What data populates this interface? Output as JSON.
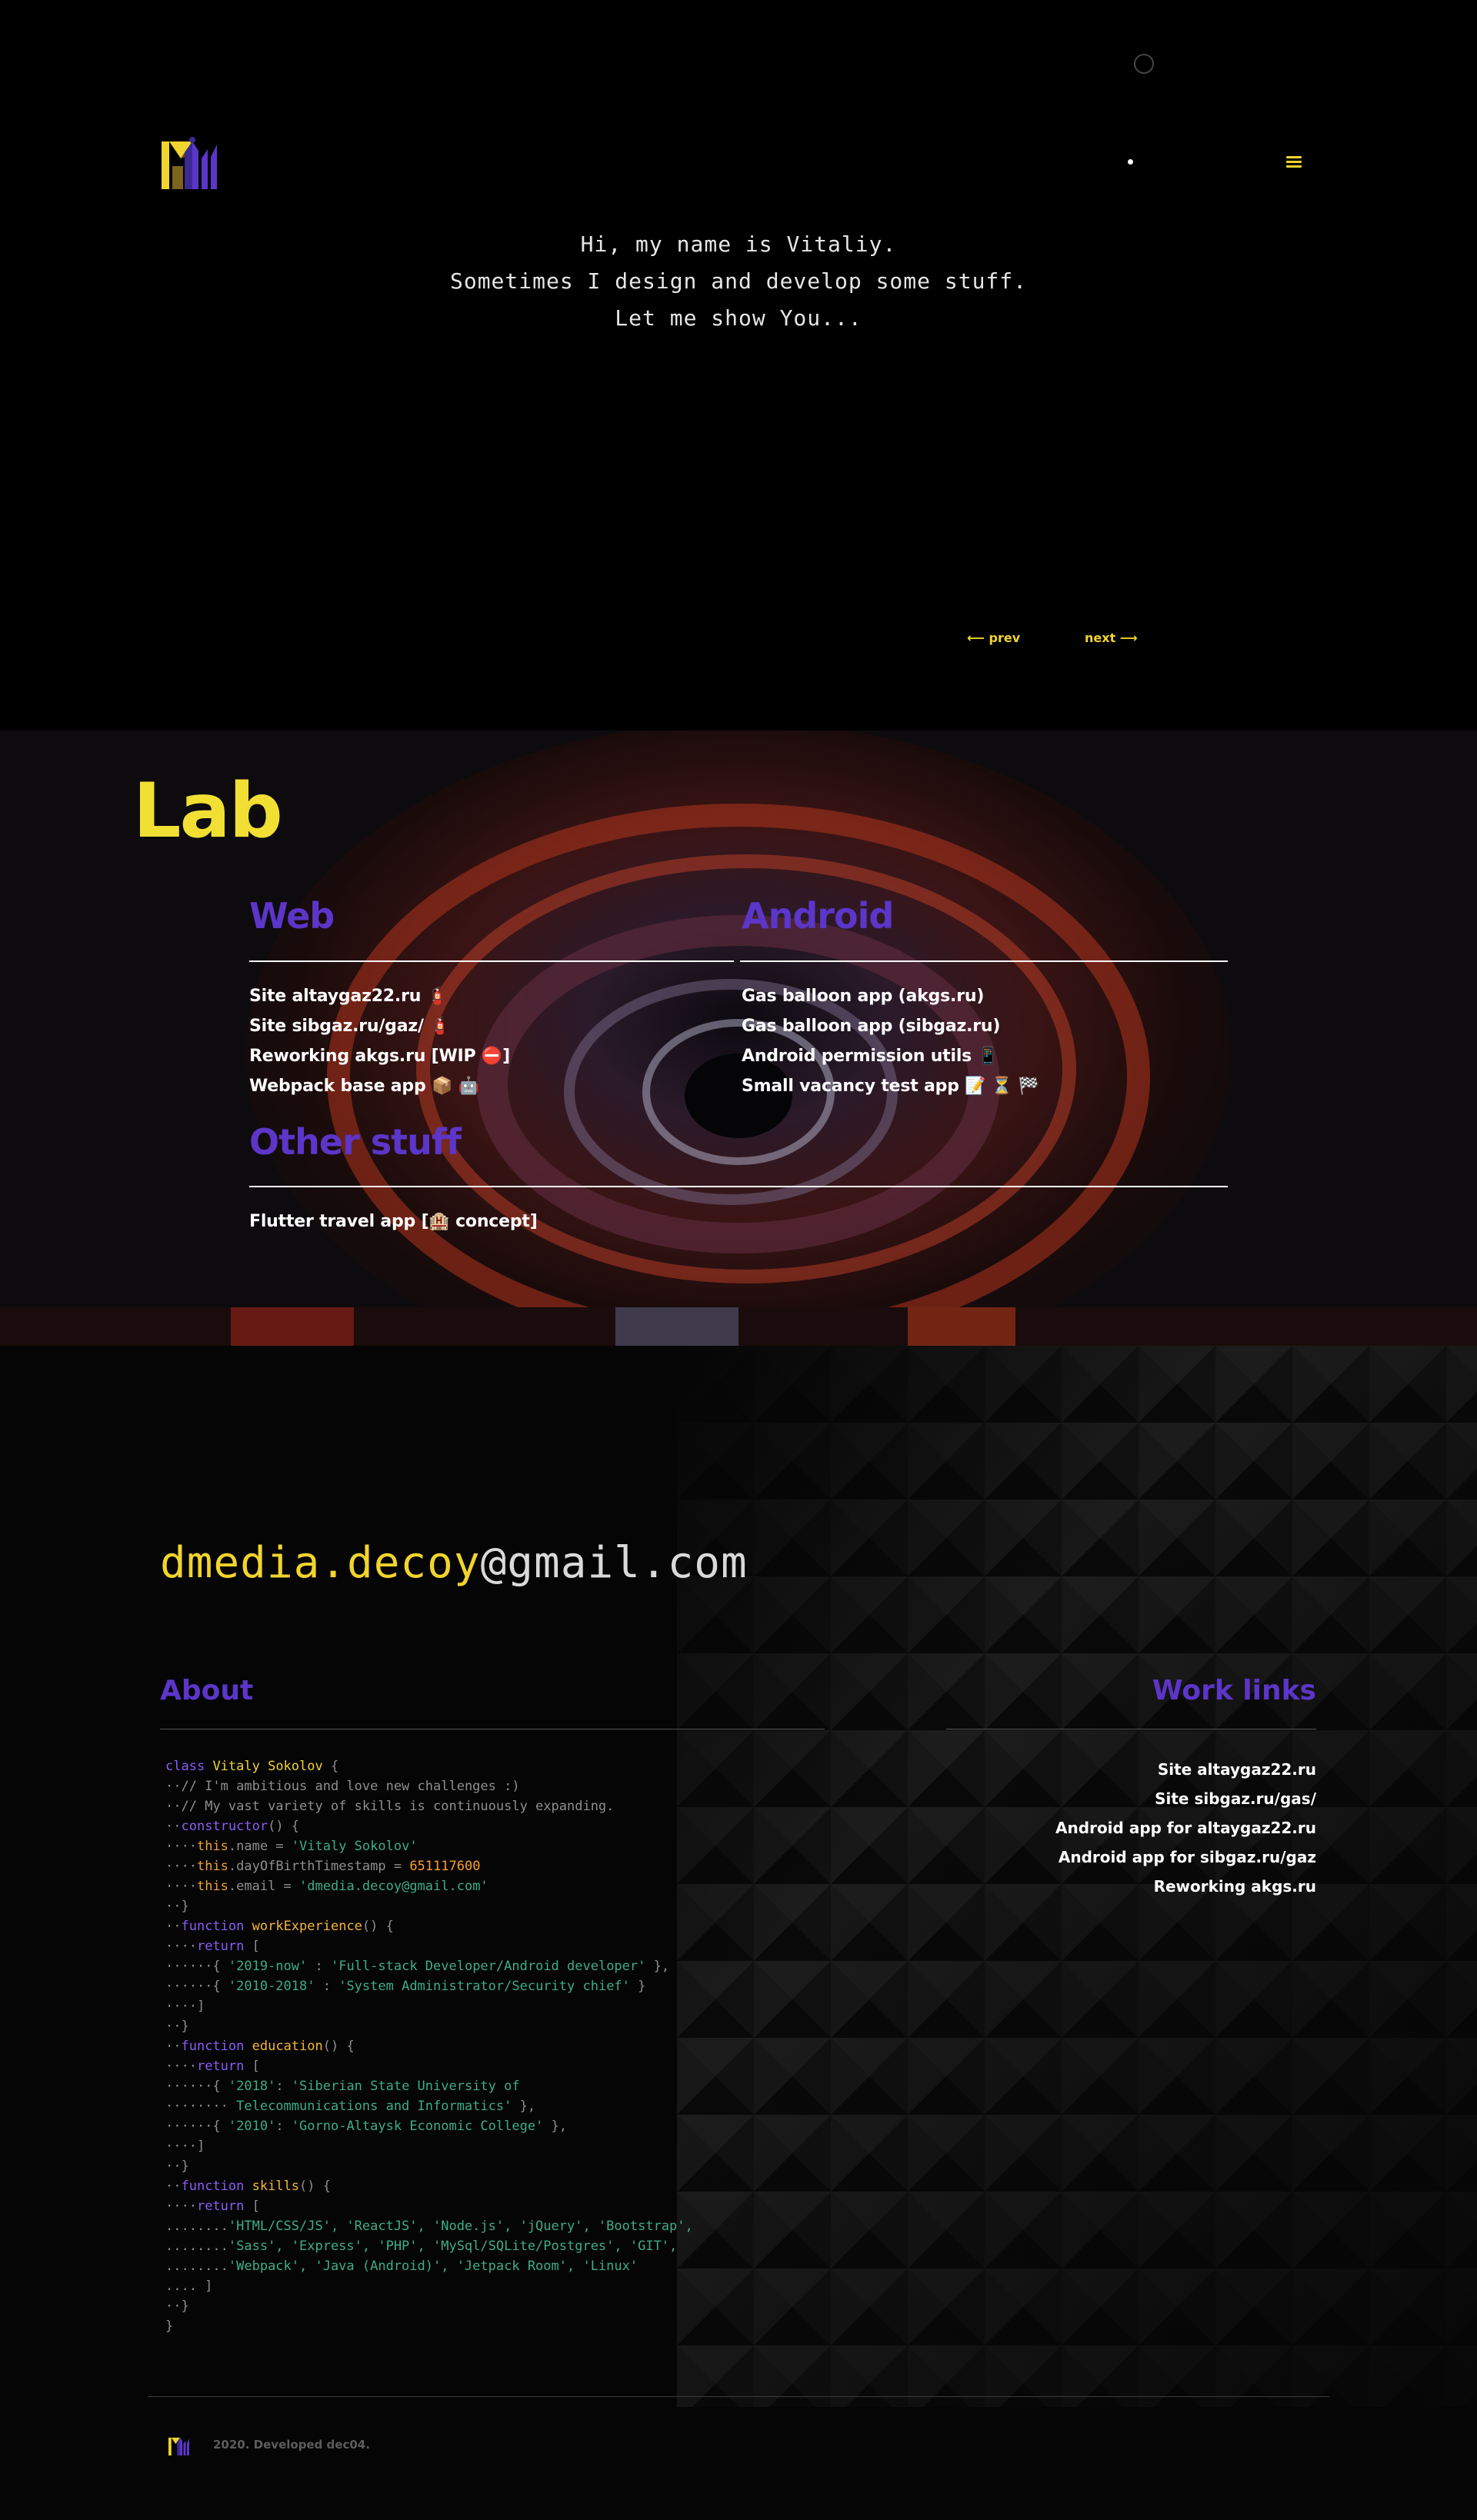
{
  "hero": {
    "intro_lines": [
      "Hi, my name is Vitaliy.",
      "Sometimes I design and develop some stuff.",
      "Let me show You..."
    ],
    "prev_label": "⟵ prev",
    "next_label": "next ⟶"
  },
  "lab": {
    "title": "Lab",
    "web": {
      "title": "Web",
      "items": [
        "Site altaygaz22.ru 🧯",
        "Site sibgaz.ru/gaz/ 🧯",
        "Reworking akgs.ru [WIP ⛔]",
        "Webpack base app 📦 🤖"
      ]
    },
    "android": {
      "title": "Android",
      "items": [
        "Gas balloon app (akgs.ru)",
        "Gas balloon app (sibgaz.ru)",
        "Android permission utils 📱",
        "Small vacancy test app 📝 ⏳ 🏁"
      ]
    },
    "other": {
      "title": "Other stuff",
      "items": [
        "Flutter travel app [🏨 concept]"
      ]
    }
  },
  "contact": {
    "email_local": "dmedia.decoy",
    "email_domain": "@gmail.com",
    "about_title": "About",
    "work_links_title": "Work links",
    "work_links": [
      "Site altaygaz22.ru",
      "Site sibgaz.ru/gas/",
      "Android app for altaygaz22.ru",
      "Android app for sibgaz.ru/gaz",
      "Reworking akgs.ru"
    ]
  },
  "code": {
    "class_kw": "class",
    "class_name": "Vitaly Sokolov",
    "comment_1": "// I'm ambitious and love new challenges :)",
    "comment_2": "// My vast variety of skills is continuously expanding.",
    "constructor_kw": "constructor",
    "this_kw": "this",
    "name_prop": ".name = ",
    "name_val": "'Vitaly Sokolov'",
    "dob_prop": ".dayOfBirthTimestamp = ",
    "dob_val": "651117600",
    "email_prop": ".email = ",
    "email_val": "'dmedia.decoy@gmail.com'",
    "function_kw": "function",
    "return_kw": "return",
    "fn_work": "workExperience",
    "work_1_key": "'2019-now'",
    "work_1_val": "'Full-stack Developer/Android developer'",
    "work_2_key": "'2010-2018'",
    "work_2_val": "'System Administrator/Security chief'",
    "fn_edu": "education",
    "edu_1_key": "'2018'",
    "edu_1_val_a": "'Siberian State University of",
    "edu_1_val_b": "Telecommunications and Informatics'",
    "edu_2_key": "'2010'",
    "edu_2_val": "'Gorno-Altaysk Economic College'",
    "fn_skills": "skills",
    "skills_1": "'HTML/CSS/JS', 'ReactJS', 'Node.js', 'jQuery', 'Bootstrap',",
    "skills_2": "'Sass', 'Express', 'PHP', 'MySql/SQLite/Postgres', 'GIT',",
    "skills_3": "'Webpack', 'Java (Android)', 'Jetpack Room', 'Linux'"
  },
  "footer": {
    "text": "2020. Developed dec04."
  },
  "colors": {
    "accent_yellow": "#f1d42d",
    "accent_purple": "#5c35c9",
    "background": "#000000"
  },
  "icons": {
    "menu": "hamburger-icon",
    "logo": "logo-icon"
  }
}
